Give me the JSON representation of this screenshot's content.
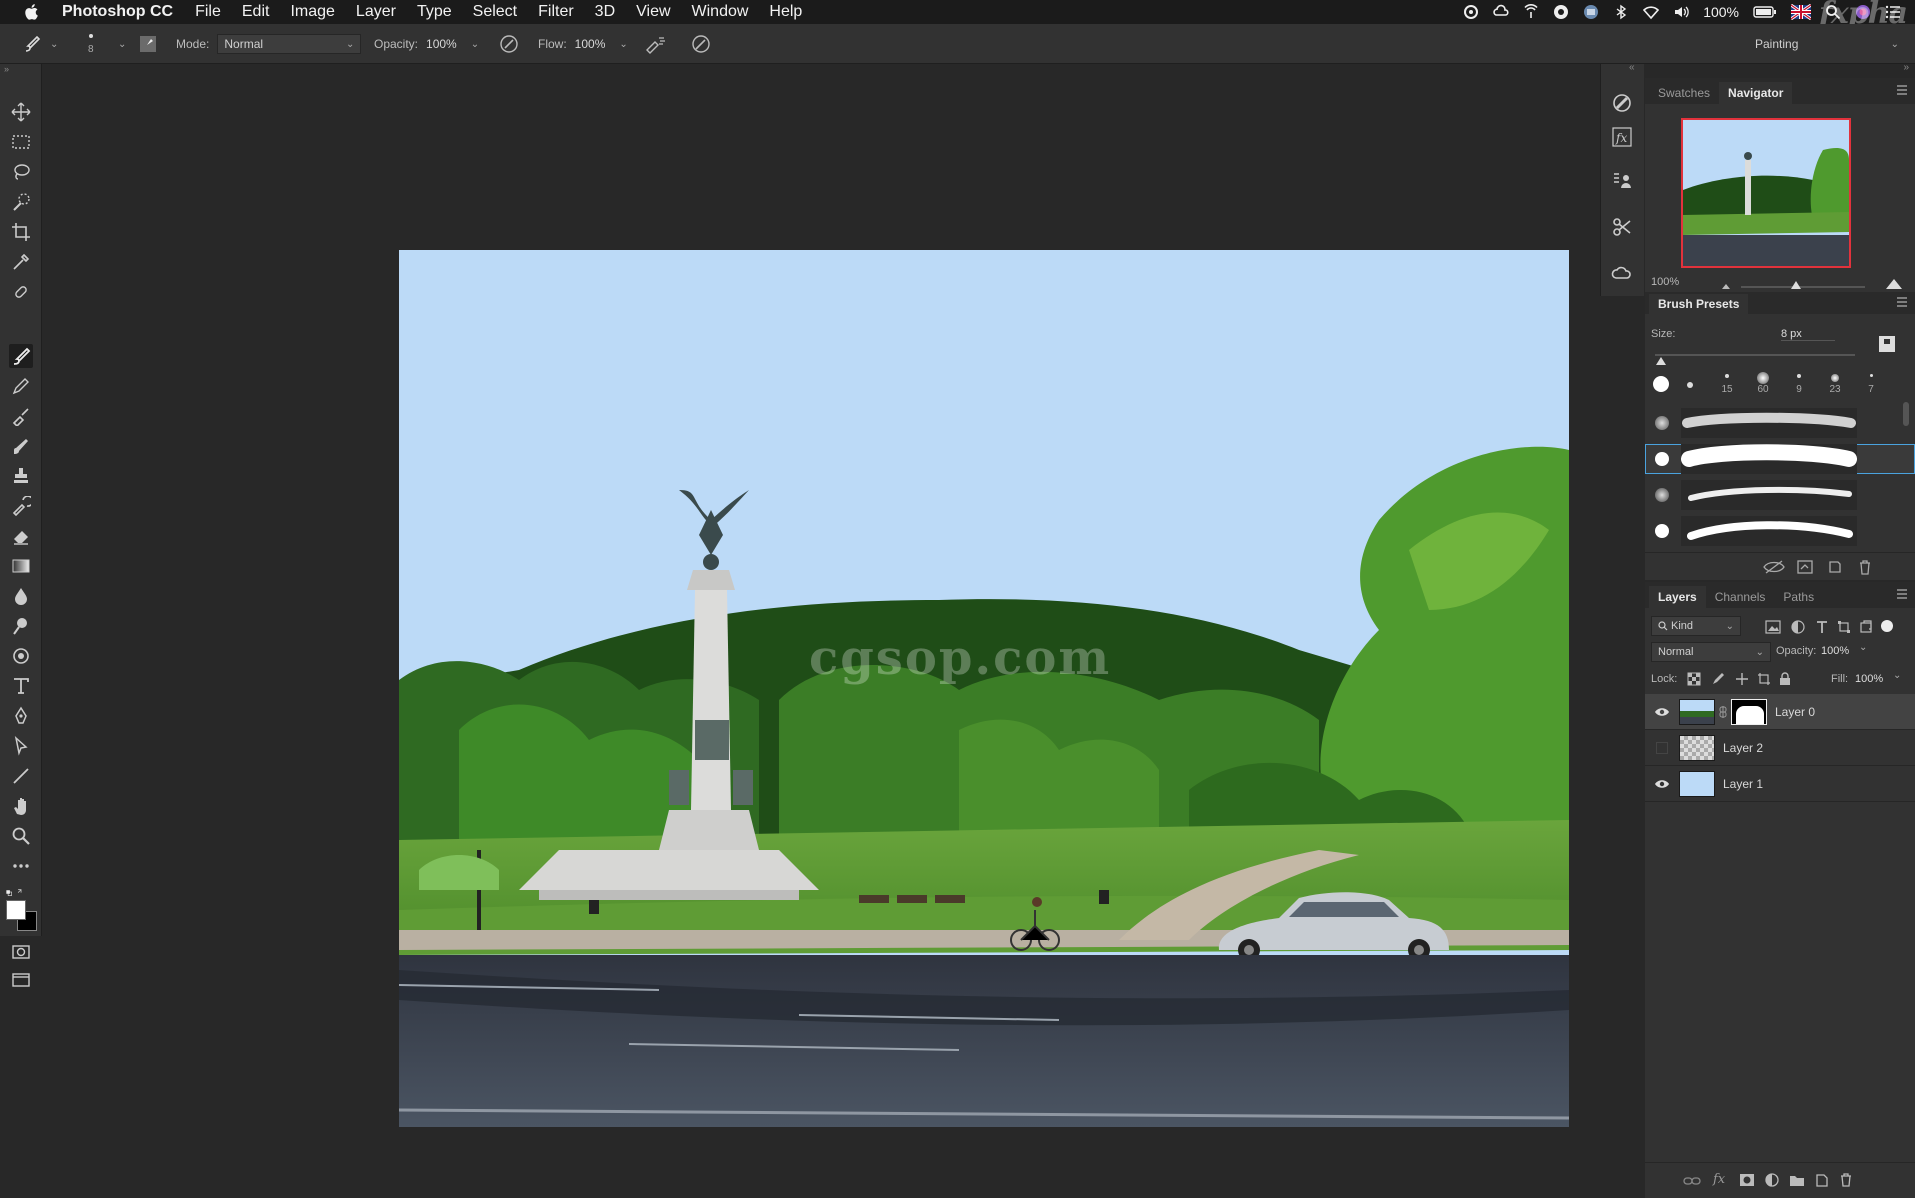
{
  "menubar": {
    "app_name": "Photoshop CC",
    "menus": [
      "File",
      "Edit",
      "Image",
      "Layer",
      "Type",
      "Select",
      "Filter",
      "3D",
      "View",
      "Window",
      "Help"
    ],
    "battery": "100%",
    "watermark": "fxpha"
  },
  "options_bar": {
    "brush_size": "8",
    "mode_label": "Mode:",
    "mode_value": "Normal",
    "opacity_label": "Opacity:",
    "opacity_value": "100%",
    "flow_label": "Flow:",
    "flow_value": "100%",
    "workspace": "Painting"
  },
  "document": {
    "watermark_text": "cgsop.com"
  },
  "navigator": {
    "tabs": [
      "Swatches",
      "Navigator"
    ],
    "active_tab": "Navigator",
    "zoom": "100%",
    "zoom_level": 0.44
  },
  "brush_presets": {
    "title": "Brush Presets",
    "size_label": "Size:",
    "size_value": "8 px",
    "tip_sizes": [
      "",
      "",
      "15",
      "60",
      "9",
      "23",
      "7"
    ]
  },
  "layers_panel": {
    "tabs": [
      "Layers",
      "Channels",
      "Paths"
    ],
    "active_tab": "Layers",
    "filter_kind": "Kind",
    "blend_mode": "Normal",
    "opacity_label": "Opacity:",
    "opacity_value": "100%",
    "lock_label": "Lock:",
    "fill_label": "Fill:",
    "fill_value": "100%",
    "layers": [
      {
        "name": "Layer 0",
        "visible": true,
        "selected": true
      },
      {
        "name": "Layer 2",
        "visible": false,
        "selected": false
      },
      {
        "name": "Layer 1",
        "visible": true,
        "selected": false
      }
    ]
  },
  "colors": {
    "ui_dark": "#282828",
    "panel": "#323232",
    "sky": "#bcdaf7",
    "selection": "#434343",
    "nav_frame": "#e2323c"
  }
}
